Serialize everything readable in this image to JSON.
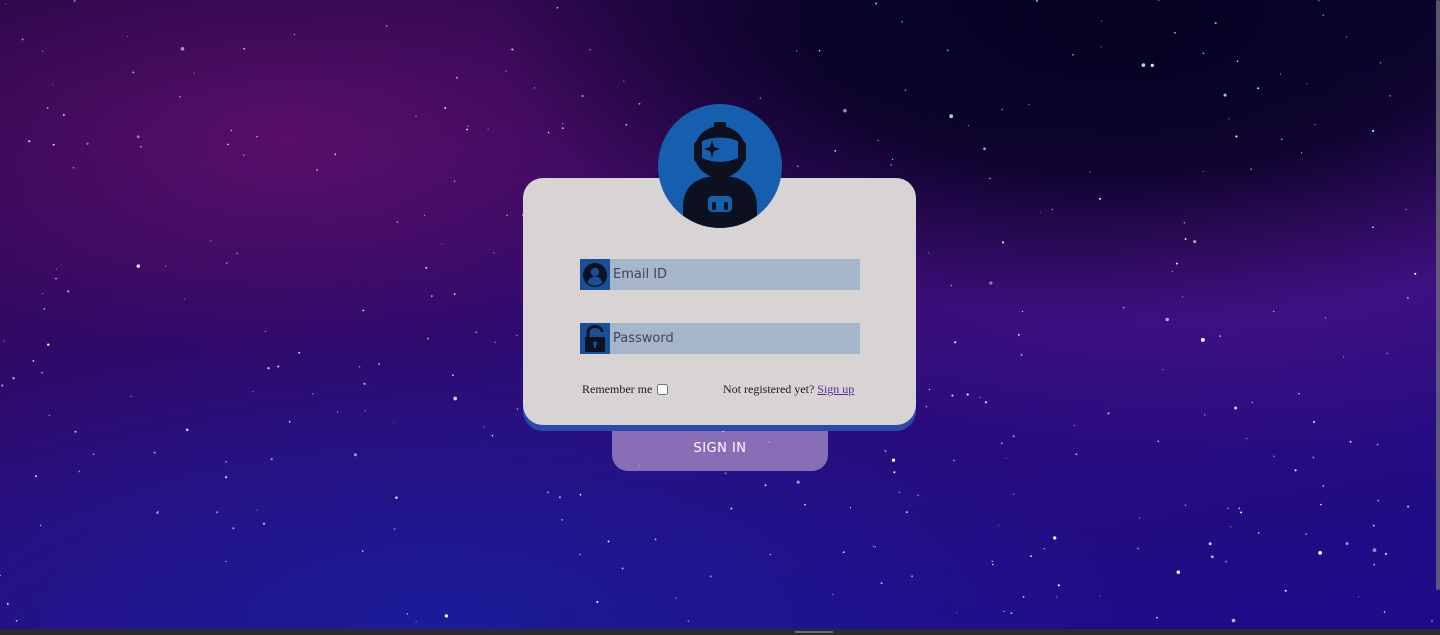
{
  "login": {
    "email_placeholder": "Email ID",
    "password_placeholder": "Password",
    "remember_label": "Remember me",
    "not_registered_text": "Not registered yet?",
    "signup_link": "Sign up",
    "signin_button": "SIGN IN"
  },
  "icons": {
    "avatar": "astronaut-icon",
    "email": "user-icon",
    "password": "unlock-icon"
  },
  "colors": {
    "card_background": "#d9d4d4",
    "avatar_background": "#155fae",
    "input_background": "#a7b5cb",
    "icon_box": "#1a4f97",
    "signin_button": "#c4a8d6",
    "link": "#5b2a9a"
  }
}
